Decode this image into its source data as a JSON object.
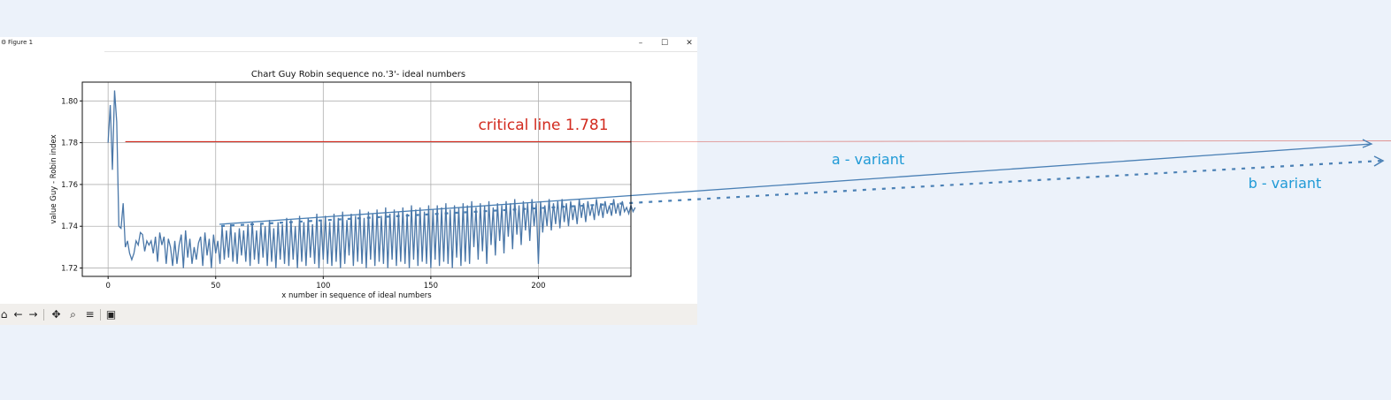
{
  "window": {
    "title": "Figure 1",
    "minimize_icon": "minimize-icon",
    "maximize_icon": "maximize-icon",
    "close_icon": "close-icon"
  },
  "toolbar": {
    "buttons": [
      {
        "name": "home-icon",
        "glyph": "⌂"
      },
      {
        "name": "back-arrow-icon",
        "glyph": "←"
      },
      {
        "name": "forward-arrow-icon",
        "glyph": "→"
      },
      {
        "name": "pan-icon",
        "glyph": "✥"
      },
      {
        "name": "zoom-icon",
        "glyph": "⌕"
      },
      {
        "name": "configure-subplots-icon",
        "glyph": "≡"
      },
      {
        "name": "save-icon",
        "glyph": "▣"
      }
    ]
  },
  "colors": {
    "line": "#4a77a8",
    "critical": "#d22b1f",
    "annotation": "#1f9ad6",
    "variant_line": "#4a80b5"
  },
  "chart_data": {
    "type": "line",
    "title": "Chart Guy Robin sequence no.'3'- ideal numbers",
    "xlabel": "x number in sequence of ideal numbers",
    "ylabel": "value Guy - Robin index",
    "xlim": [
      -12,
      243
    ],
    "ylim": [
      1.716,
      1.809
    ],
    "xticks": [
      0,
      50,
      100,
      150,
      200
    ],
    "yticks": [
      1.72,
      1.74,
      1.76,
      1.78,
      1.8
    ],
    "ytick_labels": [
      "1.72",
      "1.74",
      "1.76",
      "1.78",
      "1.80"
    ],
    "grid": true,
    "critical_line": {
      "label": "critical line 1.781",
      "y": 1.7805,
      "x_start": 8
    },
    "annotations": {
      "a_variant": "a - variant",
      "b_variant": "b -  variant"
    },
    "series": [
      {
        "values": [
          1.78,
          1.798,
          1.767,
          1.805,
          1.79,
          1.74,
          1.739,
          1.751,
          1.73,
          1.733,
          1.727,
          1.724,
          1.727,
          1.733,
          1.731,
          1.737,
          1.736,
          1.728,
          1.733,
          1.731,
          1.733,
          1.727,
          1.735,
          1.723,
          1.737,
          1.731,
          1.735,
          1.722,
          1.734,
          1.73,
          1.721,
          1.733,
          1.722,
          1.731,
          1.736,
          1.72,
          1.738,
          1.725,
          1.734,
          1.722,
          1.73,
          1.724,
          1.732,
          1.735,
          1.721,
          1.737,
          1.726,
          1.734,
          1.72,
          1.736,
          1.727,
          1.733,
          1.722,
          1.74,
          1.724,
          1.738,
          1.725,
          1.741,
          1.723,
          1.737,
          1.722,
          1.739,
          1.726,
          1.738,
          1.723,
          1.741,
          1.721,
          1.742,
          1.724,
          1.738,
          1.722,
          1.741,
          1.725,
          1.74,
          1.721,
          1.743,
          1.723,
          1.739,
          1.72,
          1.742,
          1.724,
          1.741,
          1.722,
          1.744,
          1.721,
          1.743,
          1.724,
          1.74,
          1.72,
          1.745,
          1.723,
          1.742,
          1.721,
          1.744,
          1.725,
          1.741,
          1.722,
          1.746,
          1.72,
          1.743,
          1.724,
          1.745,
          1.722,
          1.742,
          1.721,
          1.746,
          1.723,
          1.744,
          1.72,
          1.747,
          1.722,
          1.743,
          1.726,
          1.746,
          1.721,
          1.745,
          1.723,
          1.748,
          1.722,
          1.744,
          1.72,
          1.747,
          1.724,
          1.746,
          1.721,
          1.748,
          1.723,
          1.745,
          1.722,
          1.749,
          1.72,
          1.746,
          1.724,
          1.748,
          1.721,
          1.747,
          1.723,
          1.749,
          1.722,
          1.746,
          1.72,
          1.75,
          1.724,
          1.748,
          1.721,
          1.749,
          1.723,
          1.747,
          1.722,
          1.75,
          1.72,
          1.748,
          1.724,
          1.75,
          1.721,
          1.749,
          1.723,
          1.751,
          1.722,
          1.748,
          1.72,
          1.75,
          1.725,
          1.749,
          1.721,
          1.751,
          1.723,
          1.75,
          1.722,
          1.752,
          1.73,
          1.749,
          1.724,
          1.751,
          1.728,
          1.75,
          1.722,
          1.752,
          1.731,
          1.749,
          1.726,
          1.751,
          1.733,
          1.75,
          1.727,
          1.752,
          1.735,
          1.751,
          1.729,
          1.753,
          1.736,
          1.75,
          1.731,
          1.752,
          1.738,
          1.751,
          1.733,
          1.753,
          1.74,
          1.751,
          1.722,
          1.752,
          1.737,
          1.75,
          1.74,
          1.753,
          1.738,
          1.751,
          1.741,
          1.752,
          1.739,
          1.753,
          1.742,
          1.751,
          1.74,
          1.752,
          1.743,
          1.75,
          1.741,
          1.753,
          1.744,
          1.751,
          1.742,
          1.752,
          1.745,
          1.75,
          1.743,
          1.753,
          1.745,
          1.751,
          1.744,
          1.752,
          1.746,
          1.75,
          1.745,
          1.753,
          1.746,
          1.751,
          1.745,
          1.752,
          1.747,
          1.749,
          1.746,
          1.75,
          1.747,
          1.749
        ]
      }
    ]
  }
}
